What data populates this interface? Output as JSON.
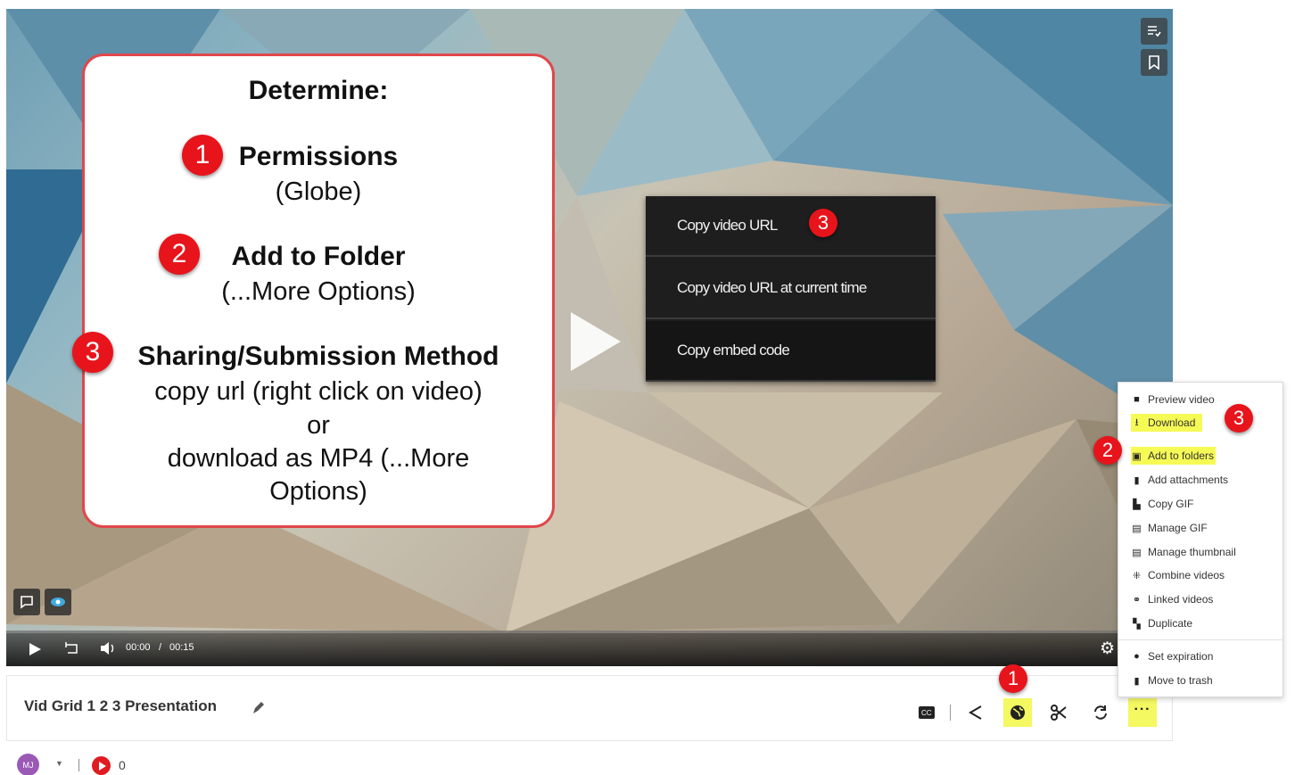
{
  "callout": {
    "heading": "Determine:",
    "item1_badge": "1",
    "item1_title": "Permissions",
    "item1_sub": "(Globe)",
    "item2_badge": "2",
    "item2_title": "Add to Folder",
    "item2_sub": "(...More Options)",
    "item3_badge": "3",
    "item3_title": "Sharing/Submission Method",
    "item3_line1": "copy url (right click on video)",
    "item3_line2": "or",
    "item3_line3": "download as MP4 (...More",
    "item3_line4": "Options)"
  },
  "context_menu": {
    "items": [
      "Copy video URL",
      "Copy video URL at current time",
      "Copy embed code"
    ],
    "badge": "3"
  },
  "player": {
    "time_current": "00:00",
    "time_separator": "/",
    "time_total": "00:15"
  },
  "more_menu": {
    "items": [
      {
        "label": "Preview video",
        "icon": "video-camera-icon"
      },
      {
        "label": "Download",
        "icon": "download-icon"
      },
      {
        "label": "Add to folders",
        "icon": "folder-icon"
      },
      {
        "label": "Add attachments",
        "icon": "attachment-icon"
      },
      {
        "label": "Copy GIF",
        "icon": "copy-gif-icon"
      },
      {
        "label": "Manage GIF",
        "icon": "manage-gif-icon"
      },
      {
        "label": "Manage thumbnail",
        "icon": "thumbnail-icon"
      },
      {
        "label": "Combine videos",
        "icon": "combine-icon"
      },
      {
        "label": "Linked videos",
        "icon": "link-icon"
      },
      {
        "label": "Duplicate",
        "icon": "duplicate-icon"
      },
      {
        "label": "Set expiration",
        "icon": "clock-icon"
      },
      {
        "label": "Move to trash",
        "icon": "trash-icon"
      }
    ],
    "badge_download": "3",
    "badge_folders": "2"
  },
  "footer": {
    "title": "Vid Grid 1 2 3 Presentation",
    "badge_permissions": "1",
    "avatar_initials": "MJ",
    "view_count": "0"
  },
  "colors": {
    "badge_red": "#e8141b",
    "highlight_yellow": "#f6fa55",
    "callout_border": "#e0474c"
  }
}
